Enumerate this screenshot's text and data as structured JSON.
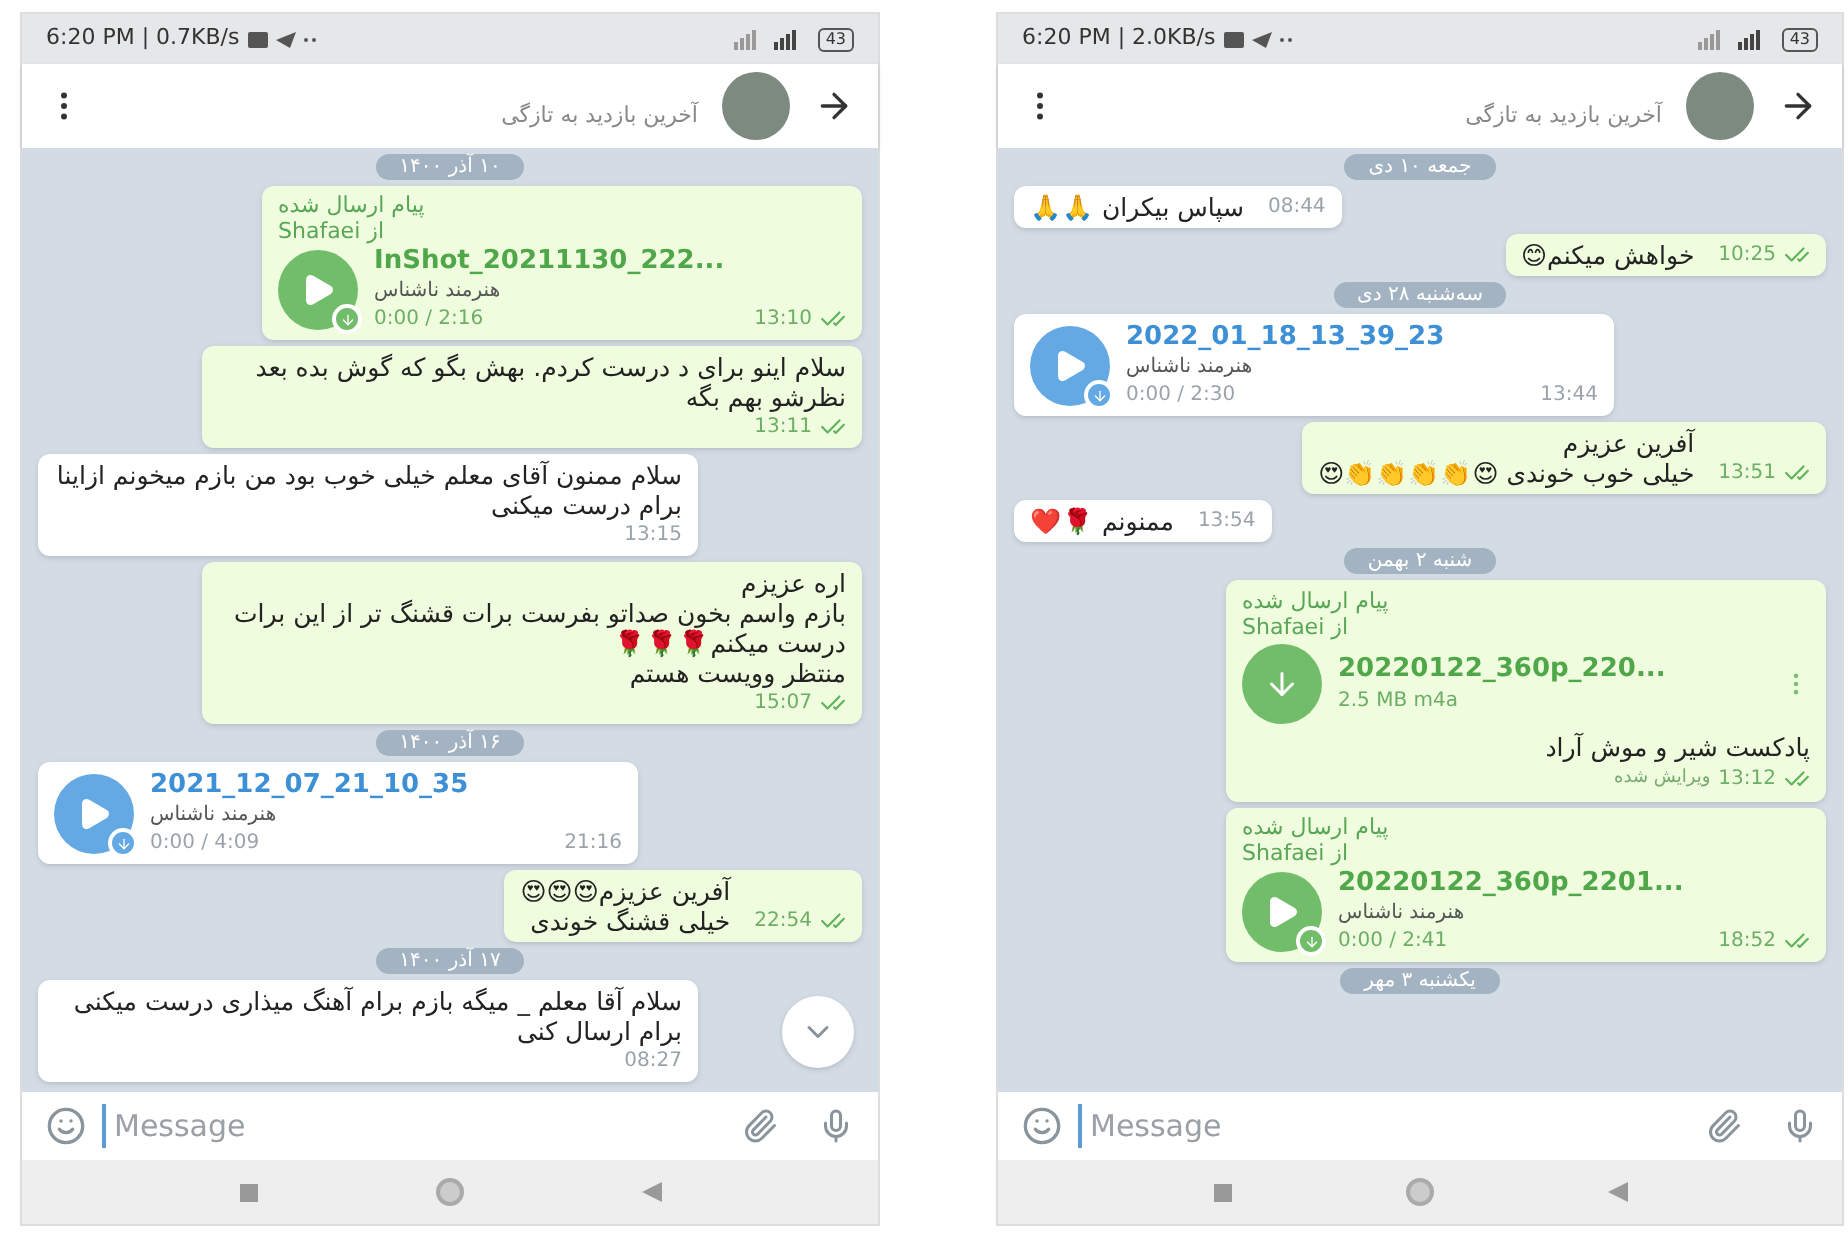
{
  "left_screen": {
    "status": {
      "time": "6:20 PM | 0.7KB/s",
      "battery": "43"
    },
    "header": {
      "last_seen": "آخرین بازدید به تازگی"
    },
    "scroll_down_button": true,
    "messages": [
      {
        "kind": "date",
        "text": "۱۰ آذر ۱۴۰۰"
      },
      {
        "kind": "audio",
        "out": true,
        "forwarded_label": "پیام ارسال شده",
        "forwarded_from": "از Shafaei",
        "title": "InShot_20211130_222...",
        "performer": "هنرمند ناشناس",
        "duration": "0:00 / 2:16",
        "time": "13:10",
        "read": true
      },
      {
        "kind": "text",
        "out": true,
        "text": "سلام اینو برای د درست کردم. بهش بگو که گوش بده بعد نظرشو بهم بگه",
        "time": "13:11",
        "read": true
      },
      {
        "kind": "text",
        "out": false,
        "text": "سلام ممنون آقای معلم خیلی خوب بود من بازم میخونم ازاینا برام درست میکنی",
        "time": "13:15"
      },
      {
        "kind": "text",
        "out": true,
        "text": "اره عزیزم\nبازم واسم بخون صداتو بفرست برات قشنگ تر از این برات درست میکنم🌹🌹🌹\nمنتظر وویست هستم",
        "time": "15:07",
        "read": true
      },
      {
        "kind": "date",
        "text": "۱۶ آذر ۱۴۰۰"
      },
      {
        "kind": "audio",
        "out": false,
        "title": "2021_12_07_21_10_35",
        "performer": "هنرمند ناشناس",
        "duration": "0:00 / 4:09",
        "time": "21:16"
      },
      {
        "kind": "text",
        "out": true,
        "text": "آفرین عزیزم😍😍😍\nخیلی قشنگ خوندی",
        "time": "22:54",
        "read": true
      },
      {
        "kind": "date",
        "text": "۱۷ آذر ۱۴۰۰"
      },
      {
        "kind": "text",
        "out": false,
        "text": "سلام آقا معلم _ میگه بازم برام آهنگ میذاری درست میکنی برام ارسال کنی",
        "time": "08:27"
      }
    ],
    "input": {
      "placeholder": "Message"
    }
  },
  "right_screen": {
    "status": {
      "time": "6:20 PM | 2.0KB/s",
      "battery": "43"
    },
    "header": {
      "last_seen": "آخرین بازدید به تازگی"
    },
    "scroll_down_button": false,
    "messages": [
      {
        "kind": "date",
        "text": "جمعه ۱۰ دی"
      },
      {
        "kind": "text",
        "out": false,
        "text": "سپاس بیکران 🙏🙏",
        "time": "08:44"
      },
      {
        "kind": "text",
        "out": true,
        "text": "خواهش میکنم😊",
        "time": "10:25",
        "read": true
      },
      {
        "kind": "date",
        "text": "سه‌شنبه ۲۸ دی"
      },
      {
        "kind": "audio",
        "out": false,
        "title": "2022_01_18_13_39_23",
        "performer": "هنرمند ناشناس",
        "duration": "0:00 / 2:30",
        "time": "13:44"
      },
      {
        "kind": "text",
        "out": true,
        "text": "آفرین عزیزم\nخیلی خوب خوندی 😍👏👏👏👏😍",
        "time": "13:51",
        "read": true
      },
      {
        "kind": "text",
        "out": false,
        "text": "ممنونم 🌹❤️",
        "time": "13:54"
      },
      {
        "kind": "date",
        "text": "شنبه ۲ بهمن"
      },
      {
        "kind": "file",
        "out": true,
        "forwarded_label": "پیام ارسال شده",
        "forwarded_from": "از Shafaei",
        "title": "20220122_360p_220...",
        "size": "2.5 MB m4a",
        "caption": "پادکست شیر و موش آراد",
        "edited": "ویرایش شده",
        "time": "13:12",
        "read": true
      },
      {
        "kind": "audio",
        "out": true,
        "forwarded_label": "پیام ارسال شده",
        "forwarded_from": "از Shafaei",
        "title": "20220122_360p_2201...",
        "performer": "هنرمند ناشناس",
        "duration": "0:00 / 2:41",
        "time": "18:52",
        "read": true
      },
      {
        "kind": "date",
        "text": "یکشنبه ۳ مهر"
      }
    ],
    "input": {
      "placeholder": "Message"
    }
  }
}
